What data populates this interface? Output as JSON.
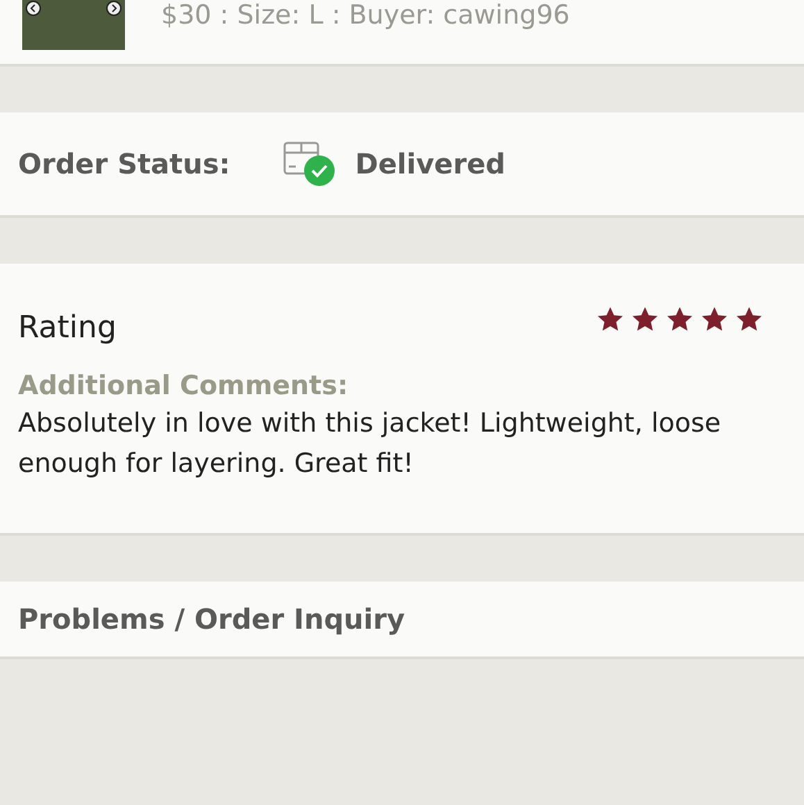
{
  "listing": {
    "summary": "$30 : Size: L : Buyer: cawing96"
  },
  "order_status": {
    "label": "Order Status:",
    "value": "Delivered"
  },
  "rating": {
    "label": "Rating",
    "stars": 5,
    "comments_label": "Additional Comments:",
    "comments": "Absolutely in love with this jacket! Lightweight, loose enough for layering. Great fit!"
  },
  "problems": {
    "label": "Problems / Order Inquiry"
  }
}
